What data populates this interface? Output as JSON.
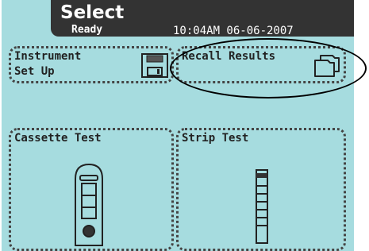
{
  "header": {
    "title": "Select",
    "status": "Ready",
    "datetime": "10:04AM 06-06-2007"
  },
  "buttons": {
    "instrument": {
      "label": "Instrument\nSet Up",
      "icon": "floppy-disk-icon"
    },
    "recall": {
      "label": "Recall Results",
      "icon": "folder-icon"
    },
    "cassette": {
      "label": "Cassette Test",
      "icon": "cassette-icon"
    },
    "strip": {
      "label": "Strip Test",
      "icon": "strip-icon"
    }
  },
  "colors": {
    "screen": "#a6dcdf",
    "header": "#333333",
    "annotation": "#000000"
  }
}
